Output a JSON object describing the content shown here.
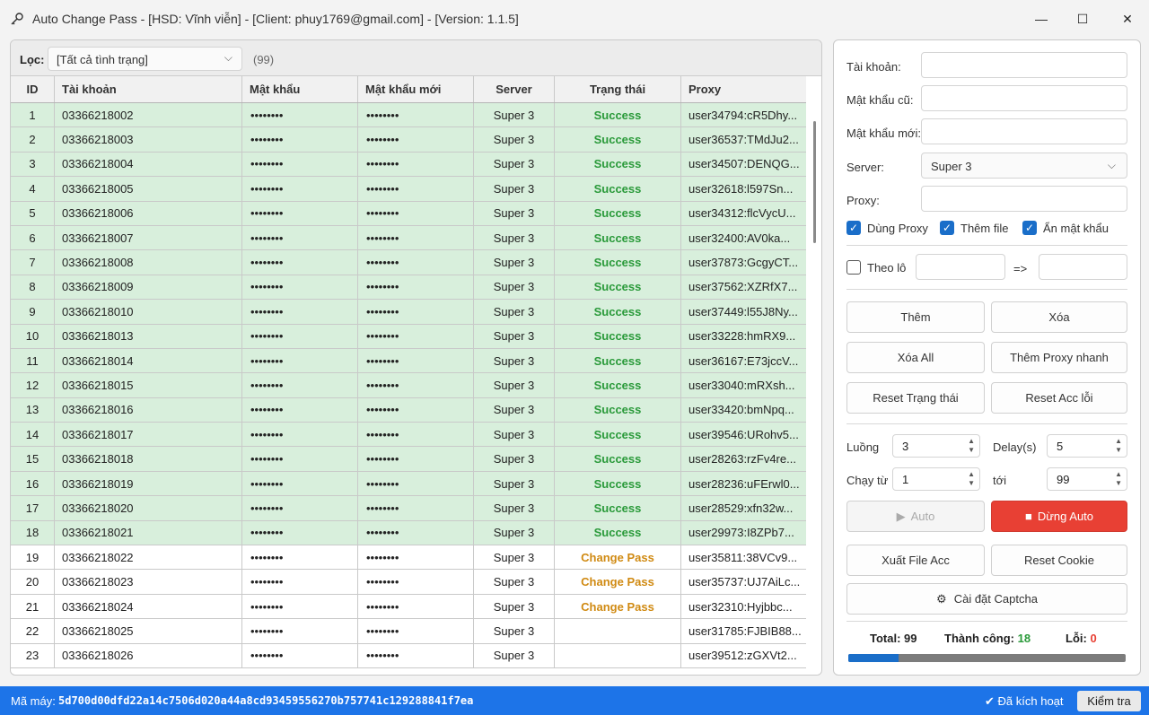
{
  "window": {
    "title": "Auto Change Pass - [HSD: Vĩnh viễn] - [Client: phuy1769@gmail.com] - [Version: 1.1.5]",
    "minimize": "—",
    "maximize": "☐",
    "close": "✕"
  },
  "filter": {
    "label": "Lọc:",
    "selected": "[Tất cả tình trạng]",
    "count": "(99)"
  },
  "table": {
    "headers": [
      "ID",
      "Tài khoản",
      "Mật khẩu",
      "Mật khẩu mới",
      "Server",
      "Trạng thái",
      "Proxy"
    ],
    "rows": [
      {
        "id": "1",
        "account": "03366218002",
        "password": "••••••••",
        "new_password": "••••••••",
        "server": "Super 3",
        "status": "Success",
        "proxy": "user34794:cR5Dhy..."
      },
      {
        "id": "2",
        "account": "03366218003",
        "password": "••••••••",
        "new_password": "••••••••",
        "server": "Super 3",
        "status": "Success",
        "proxy": "user36537:TMdJu2..."
      },
      {
        "id": "3",
        "account": "03366218004",
        "password": "••••••••",
        "new_password": "••••••••",
        "server": "Super 3",
        "status": "Success",
        "proxy": "user34507:DENQG..."
      },
      {
        "id": "4",
        "account": "03366218005",
        "password": "••••••••",
        "new_password": "••••••••",
        "server": "Super 3",
        "status": "Success",
        "proxy": "user32618:l597Sn..."
      },
      {
        "id": "5",
        "account": "03366218006",
        "password": "••••••••",
        "new_password": "••••••••",
        "server": "Super 3",
        "status": "Success",
        "proxy": "user34312:flcVycU..."
      },
      {
        "id": "6",
        "account": "03366218007",
        "password": "••••••••",
        "new_password": "••••••••",
        "server": "Super 3",
        "status": "Success",
        "proxy": "user32400:AV0ka..."
      },
      {
        "id": "7",
        "account": "03366218008",
        "password": "••••••••",
        "new_password": "••••••••",
        "server": "Super 3",
        "status": "Success",
        "proxy": "user37873:GcgyCT..."
      },
      {
        "id": "8",
        "account": "03366218009",
        "password": "••••••••",
        "new_password": "••••••••",
        "server": "Super 3",
        "status": "Success",
        "proxy": "user37562:XZRfX7..."
      },
      {
        "id": "9",
        "account": "03366218010",
        "password": "••••••••",
        "new_password": "••••••••",
        "server": "Super 3",
        "status": "Success",
        "proxy": "user37449:l55J8Ny..."
      },
      {
        "id": "10",
        "account": "03366218013",
        "password": "••••••••",
        "new_password": "••••••••",
        "server": "Super 3",
        "status": "Success",
        "proxy": "user33228:hmRX9..."
      },
      {
        "id": "11",
        "account": "03366218014",
        "password": "••••••••",
        "new_password": "••••••••",
        "server": "Super 3",
        "status": "Success",
        "proxy": "user36167:E73jccV..."
      },
      {
        "id": "12",
        "account": "03366218015",
        "password": "••••••••",
        "new_password": "••••••••",
        "server": "Super 3",
        "status": "Success",
        "proxy": "user33040:mRXsh..."
      },
      {
        "id": "13",
        "account": "03366218016",
        "password": "••••••••",
        "new_password": "••••••••",
        "server": "Super 3",
        "status": "Success",
        "proxy": "user33420:bmNpq..."
      },
      {
        "id": "14",
        "account": "03366218017",
        "password": "••••••••",
        "new_password": "••••••••",
        "server": "Super 3",
        "status": "Success",
        "proxy": "user39546:URohv5..."
      },
      {
        "id": "15",
        "account": "03366218018",
        "password": "••••••••",
        "new_password": "••••••••",
        "server": "Super 3",
        "status": "Success",
        "proxy": "user28263:rzFv4re..."
      },
      {
        "id": "16",
        "account": "03366218019",
        "password": "••••••••",
        "new_password": "••••••••",
        "server": "Super 3",
        "status": "Success",
        "proxy": "user28236:uFErwl0..."
      },
      {
        "id": "17",
        "account": "03366218020",
        "password": "••••••••",
        "new_password": "••••••••",
        "server": "Super 3",
        "status": "Success",
        "proxy": "user28529:xfn32w..."
      },
      {
        "id": "18",
        "account": "03366218021",
        "password": "••••••••",
        "new_password": "••••••••",
        "server": "Super 3",
        "status": "Success",
        "proxy": "user29973:I8ZPb7..."
      },
      {
        "id": "19",
        "account": "03366218022",
        "password": "••••••••",
        "new_password": "••••••••",
        "server": "Super 3",
        "status": "Change Pass",
        "proxy": "user35811:38VCv9..."
      },
      {
        "id": "20",
        "account": "03366218023",
        "password": "••••••••",
        "new_password": "••••••••",
        "server": "Super 3",
        "status": "Change Pass",
        "proxy": "user35737:UJ7AiLc..."
      },
      {
        "id": "21",
        "account": "03366218024",
        "password": "••••••••",
        "new_password": "••••••••",
        "server": "Super 3",
        "status": "Change Pass",
        "proxy": "user32310:Hyjbbc..."
      },
      {
        "id": "22",
        "account": "03366218025",
        "password": "••••••••",
        "new_password": "••••••••",
        "server": "Super 3",
        "status": "",
        "proxy": "user31785:FJBIB88..."
      },
      {
        "id": "23",
        "account": "03366218026",
        "password": "••••••••",
        "new_password": "••••••••",
        "server": "Super 3",
        "status": "",
        "proxy": "user39512:zGXVt2..."
      }
    ]
  },
  "form": {
    "account_label": "Tài khoản:",
    "old_pw_label": "Mật khẩu cũ:",
    "new_pw_label": "Mật khẩu mới:",
    "server_label": "Server:",
    "server_value": "Super 3",
    "proxy_label": "Proxy:",
    "use_proxy": "Dùng Proxy",
    "add_file": "Thêm file",
    "hide_pw": "Ẩn mật khẩu",
    "batch": "Theo lô",
    "arrow": "=>"
  },
  "buttons": {
    "add": "Thêm",
    "delete": "Xóa",
    "delete_all": "Xóa All",
    "add_proxy_fast": "Thêm Proxy nhanh",
    "reset_status": "Reset Trạng thái",
    "reset_acc_err": "Reset Acc lỗi",
    "auto": "Auto",
    "stop_auto": "Dừng Auto",
    "export_acc": "Xuất File Acc",
    "reset_cookie": "Reset Cookie",
    "captcha_settings": "Cài đặt Captcha"
  },
  "settings": {
    "threads_label": "Luồng",
    "threads": "3",
    "delay_label": "Delay(s)",
    "delay": "5",
    "run_from_label": "Chạy từ",
    "run_from": "1",
    "to_label": "tới",
    "to": "99"
  },
  "stats": {
    "total_label": "Total:",
    "total": "99",
    "success_label": "Thành công:",
    "success": "18",
    "error_label": "Lỗi:",
    "error": "0",
    "progress_fraction": 0.18
  },
  "statusbar": {
    "machine_label": "Mã máy:",
    "machine_code": "5d700d00dfd22a14c7506d020a44a8cd93459556270b757741c129288841f7ea",
    "activated": "Đã kích hoạt",
    "check_button": "Kiểm tra"
  },
  "colors": {
    "success_row": "#d8efdc",
    "success_text": "#2a9a3a",
    "change_pass_text": "#d08a12",
    "stop_button": "#e84034",
    "accent": "#1a6ec9",
    "statusbar": "#1d74e8"
  }
}
